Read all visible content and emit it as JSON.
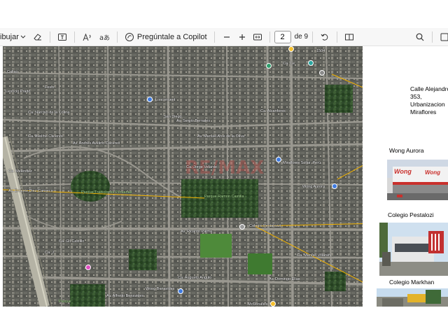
{
  "toolbar": {
    "draw_label": "ibujar",
    "copilot_label": "Pregúntale a Copilot",
    "page_current": "2",
    "page_total_label": "de 9"
  },
  "map_labels": {
    "leoncio_prado": "Leoncio Prado",
    "narciso": "Ca. Narciso de la Colina",
    "avelino": "Ca. Avelino Caceres",
    "andres_avelino": "Av. Andrés Avelino Cáceres",
    "sergio_bernales": "Av. Sergio Bernales",
    "manuel_arce": "Av. Manuel Arce de la Oliva",
    "jorge_velarde": "Ca. Jorge Velarde",
    "ernesto_diez": "Av. Ernesto Diez Canseco",
    "parque_trad": "Parque Tradiciones Peruanas",
    "parque_ramon": "Parque Ramon Castilla",
    "wong_aurora": "Wong Aurora",
    "ricardo_palma": "Av. Ricardo Palma",
    "colegio_pest": "Colegio Pestalozzi",
    "manuel_villaran": "Ca. Manuel Villarán",
    "wong_benavides": "Wong Benavides",
    "augusto": "Ca. Augusto Angulo",
    "alfredo": "Av. Alfredo Benavides",
    "mcdonalds": "McDonald's",
    "gil": "Ca. Gil Castillo",
    "ca_j": "Ca. J",
    "fesor": "Fesor",
    "parque": "Parque",
    "callao": "Callao",
    "loncon": "Lonconvent",
    "san_diego": "San Diego",
    "miraflores": "Miraflores Sollar, Perú",
    "alcanfores": "Ca. Alcanfores",
    "melendez": "Ca. Meléndez",
    "domingo": "Av. Domingo Elías",
    "ca_ce": "Ca. Ce",
    "num_1504": "1504"
  },
  "annotations": {
    "calle_1": "Calle Alejandro",
    "calle_2": "353,",
    "calle_3": "Urbanizacion",
    "calle_4": "Miraflores",
    "wong": "Wong Aurora",
    "pestalozzi": "Colegio Pestalozi",
    "markhan": "Colegio Markhan"
  },
  "photo_text": {
    "wong_sign": "Wong",
    "wong_sign_small": "Wong"
  },
  "colors": {
    "annotation_line": "#f4b400",
    "map_base": "#5a5c57",
    "pin_blue": "#3f7be0",
    "pin_green": "#2e9e6b",
    "pin_yellow": "#f6c02d",
    "pin_pink": "#e04fc0"
  }
}
